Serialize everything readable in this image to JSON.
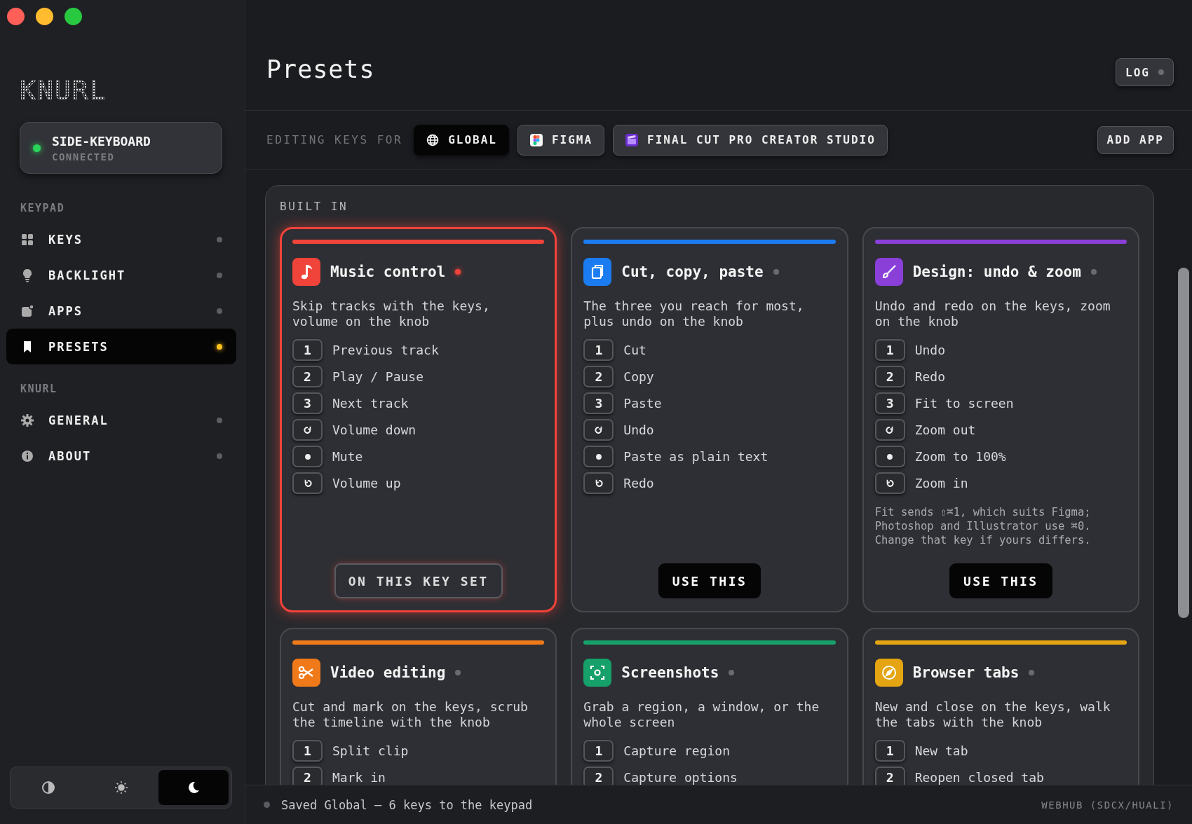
{
  "sidebar": {
    "logo": "KNURL",
    "device": {
      "name": "SIDE-KEYBOARD",
      "status": "CONNECTED",
      "connected": true
    },
    "sections": [
      {
        "heading": "KEYPAD",
        "items": [
          {
            "label": "KEYS",
            "kind": "grid",
            "selected": false
          },
          {
            "label": "BACKLIGHT",
            "kind": "bulb",
            "selected": false
          },
          {
            "label": "APPS",
            "kind": "apps",
            "selected": false
          },
          {
            "label": "PRESETS",
            "kind": "bookmark",
            "selected": true
          }
        ]
      },
      {
        "heading": "KNURL",
        "items": [
          {
            "label": "GENERAL",
            "kind": "gear",
            "selected": false
          },
          {
            "label": "ABOUT",
            "kind": "info",
            "selected": false
          }
        ]
      }
    ],
    "theme_switch": [
      {
        "kind": "contrast",
        "selected": false
      },
      {
        "kind": "sun",
        "selected": false
      },
      {
        "kind": "moon",
        "selected": true
      }
    ]
  },
  "header": {
    "title": "Presets",
    "log_button": "LOG"
  },
  "app_bar": {
    "label": "EDITING KEYS FOR",
    "apps": [
      {
        "label": "GLOBAL",
        "kind": "globe",
        "selected": true
      },
      {
        "label": "FIGMA",
        "kind": "figma",
        "selected": false
      },
      {
        "label": "FINAL CUT PRO CREATOR STUDIO",
        "kind": "clapper",
        "selected": false
      }
    ],
    "add_button": "ADD APP"
  },
  "presets": {
    "heading": "BUILT IN",
    "cards": [
      {
        "title": "Music control",
        "kind": "music",
        "color": "#f0433a",
        "active": true,
        "description": "Skip tracks with the keys, volume on the knob",
        "keys": [
          {
            "kind": "number",
            "key": "1",
            "action": "Previous track"
          },
          {
            "kind": "number",
            "key": "2",
            "action": "Play / Pause"
          },
          {
            "kind": "number",
            "key": "3",
            "action": "Next track"
          },
          {
            "kind": "knob-left",
            "action": "Volume down"
          },
          {
            "kind": "press",
            "action": "Mute"
          },
          {
            "kind": "knob-right",
            "action": "Volume up"
          }
        ],
        "button": "ON THIS KEY SET"
      },
      {
        "title": "Cut, copy, paste",
        "kind": "copy",
        "color": "#1a7cf0",
        "active": false,
        "description": "The three you reach for most, plus undo on the knob",
        "keys": [
          {
            "kind": "number",
            "key": "1",
            "action": "Cut"
          },
          {
            "kind": "number",
            "key": "2",
            "action": "Copy"
          },
          {
            "kind": "number",
            "key": "3",
            "action": "Paste"
          },
          {
            "kind": "knob-left",
            "action": "Undo"
          },
          {
            "kind": "press",
            "action": "Paste as plain text"
          },
          {
            "kind": "knob-right",
            "action": "Redo"
          }
        ],
        "button": "USE THIS"
      },
      {
        "title": "Design: undo & zoom",
        "kind": "brush",
        "color": "#8a3fd8",
        "active": false,
        "description": "Undo and redo on the keys, zoom on the knob",
        "keys": [
          {
            "kind": "number",
            "key": "1",
            "action": "Undo"
          },
          {
            "kind": "number",
            "key": "2",
            "action": "Redo"
          },
          {
            "kind": "number",
            "key": "3",
            "action": "Fit to screen"
          },
          {
            "kind": "knob-left",
            "action": "Zoom out"
          },
          {
            "kind": "press",
            "action": "Zoom to 100%"
          },
          {
            "kind": "knob-right",
            "action": "Zoom in"
          }
        ],
        "note": "Fit sends ⇧⌘1, which suits Figma; Photoshop and Illustrator use ⌘0. Change that key if yours differs.",
        "button": "USE THIS"
      },
      {
        "title": "Video editing",
        "kind": "scissors",
        "color": "#f07a1a",
        "active": false,
        "description": "Cut and mark on the keys, scrub the timeline with the knob",
        "keys": [
          {
            "kind": "number",
            "key": "1",
            "action": "Split clip"
          },
          {
            "kind": "number",
            "key": "2",
            "action": "Mark in"
          }
        ]
      },
      {
        "title": "Screenshots",
        "kind": "screenshot",
        "color": "#16a06a",
        "active": false,
        "description": "Grab a region, a window, or the whole screen",
        "keys": [
          {
            "kind": "number",
            "key": "1",
            "action": "Capture region"
          },
          {
            "kind": "number",
            "key": "2",
            "action": "Capture options"
          }
        ]
      },
      {
        "title": "Browser tabs",
        "kind": "compass",
        "color": "#e5a512",
        "active": false,
        "description": "New and close on the keys, walk the tabs with the knob",
        "keys": [
          {
            "kind": "number",
            "key": "1",
            "action": "New tab"
          },
          {
            "kind": "number",
            "key": "2",
            "action": "Reopen closed tab"
          }
        ]
      }
    ]
  },
  "status_bar": {
    "message": "Saved Global — 6 keys to the keypad",
    "credit": "WEBHUB (SDCX/HUALI)"
  }
}
